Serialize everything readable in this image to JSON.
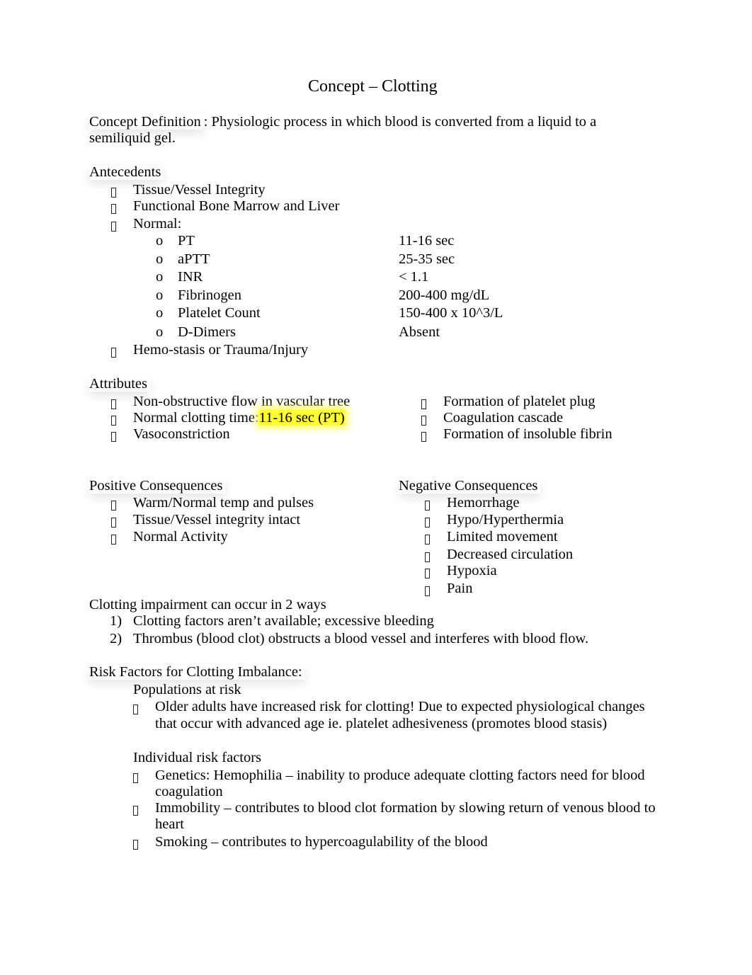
{
  "title": "Concept – Clotting",
  "definition": {
    "label": "Concept Definition",
    "line1": ": Physiologic process in which blood is converted from a liquid to a",
    "line2": "semiliquid gel."
  },
  "antecedents": {
    "heading": "Antecedents",
    "items": [
      "Tissue/Vessel Integrity",
      "Functional Bone Marrow and Liver",
      "Normal:"
    ],
    "normals": [
      {
        "name": "PT",
        "value": "11-16 sec"
      },
      {
        "name": "aPTT",
        "value": "25-35 sec"
      },
      {
        "name": "INR",
        "value": "< 1.1"
      },
      {
        "name": "Fibrinogen",
        "value": "200-400 mg/dL"
      },
      {
        "name": "Platelet Count",
        "value": "150-400 x 10^3/L"
      },
      {
        "name": "D-Dimers",
        "value": "Absent"
      }
    ],
    "last_item": "Hemo-stasis or Trauma/Injury",
    "sub_bullet": "o"
  },
  "attributes": {
    "heading": "Attributes",
    "left": [
      "Non-obstructive flow in vascular tree",
      "Normal clotting time:",
      "Vasoconstriction"
    ],
    "highlight": "11-16 sec (PT)",
    "right": [
      "Formation of platelet plug",
      "Coagulation cascade",
      "Formation of insoluble fibrin"
    ]
  },
  "positive": {
    "heading": "Positive Consequences",
    "items": [
      "Warm/Normal temp and pulses",
      "Tissue/Vessel integrity intact",
      "Normal Activity"
    ]
  },
  "negative": {
    "heading": "Negative Consequences",
    "items": [
      "Hemorrhage",
      "Hypo/Hyperthermia",
      "Limited movement",
      "Decreased circulation",
      "Hypoxia",
      "Pain"
    ]
  },
  "impairment": {
    "heading": "Clotting impairment can occur in 2 ways",
    "items": [
      {
        "num": "1)",
        "text": "Clotting factors aren’t available; excessive bleeding"
      },
      {
        "num": "2)",
        "text": "Thrombus (blood clot) obstructs a blood vessel and interferes with blood flow."
      }
    ]
  },
  "risk": {
    "heading": "Risk Factors for Clotting Imbalance:",
    "populations_heading": "Populations at risk",
    "populations": [
      {
        "l1": "Older adults have increased risk for clotting! Due to expected physiological changes",
        "l2": "that occur with advanced age ie. platelet adhesiveness (promotes blood stasis)"
      }
    ],
    "individual_heading": "Individual risk factors",
    "individual": [
      {
        "l1": "Genetics: Hemophilia – inability to produce adequate clotting factors need for blood",
        "l2": "coagulation"
      },
      {
        "l1": "Immobility – contributes to blood clot formation by slowing return of venous blood to",
        "l2": "heart"
      },
      {
        "l1": "Smoking – contributes to hypercoagulability of the blood",
        "l2": ""
      }
    ]
  }
}
